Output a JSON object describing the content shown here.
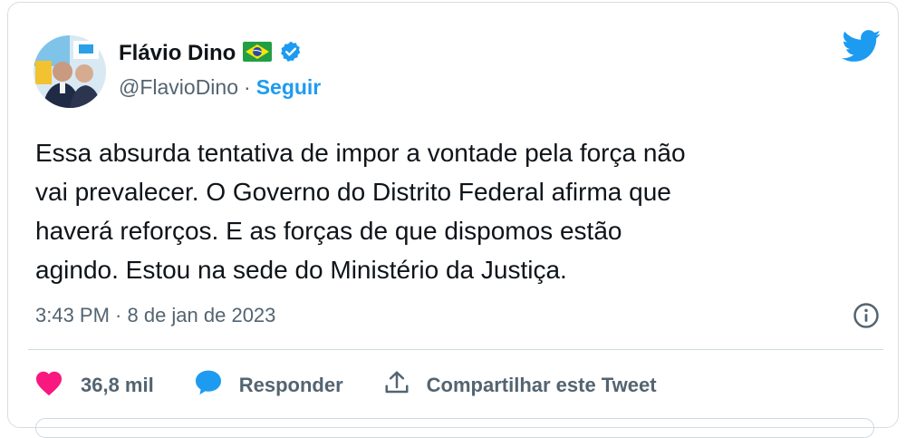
{
  "author": {
    "display_name": "Flávio Dino",
    "handle": "@FlavioDino",
    "separator": "·",
    "follow_label": "Seguir"
  },
  "icons": {
    "flag": "brazil-flag-icon",
    "verified": "verified-badge-icon",
    "logo": "twitter-bird-icon",
    "info": "info-icon",
    "like": "heart-icon",
    "reply": "speech-bubble-icon",
    "share": "share-icon"
  },
  "tweet": {
    "text_lines": [
      "Essa absurda tentativa de impor a vontade pela força não",
      "vai prevalecer. O Governo do Distrito Federal afirma que",
      "haverá reforços. E as forças de que dispomos estão",
      "agindo. Estou na sede do Ministério da Justiça."
    ],
    "timestamp": "3:43 PM · 8 de jan de 2023"
  },
  "actions": {
    "likes_count": "36,8 mil",
    "reply_label": "Responder",
    "share_label": "Compartilhar este Tweet"
  },
  "colors": {
    "accent": "#1d9bf0",
    "like": "#f91880",
    "text": "#0f1419",
    "muted": "#536471"
  }
}
